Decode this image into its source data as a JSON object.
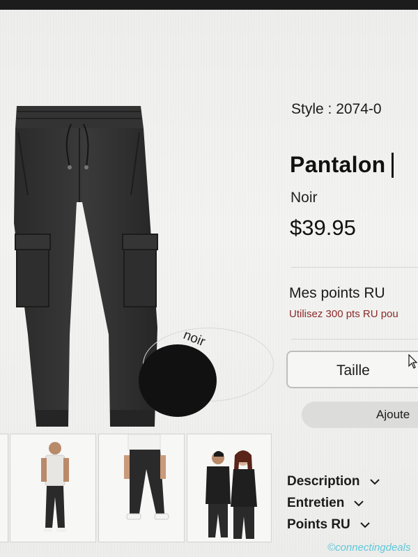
{
  "product": {
    "style_label": "Style : 2074-0",
    "title": "Pantalon",
    "color": "Noir",
    "price": "$39.95",
    "swatch_label": "noir",
    "swatch_color": "#111111"
  },
  "points": {
    "title": "Mes points RU",
    "subtitle": "Utilisez 300 pts RU pou"
  },
  "actions": {
    "size_label": "Taille",
    "add_label": "Ajoute"
  },
  "accordions": [
    {
      "label": "Description"
    },
    {
      "label": "Entretien"
    },
    {
      "label": "Points RU"
    }
  ],
  "watermark": "©connectingdeals",
  "colors": {
    "accent_text": "#8a2a2a",
    "watermark": "#5fc7d9"
  }
}
